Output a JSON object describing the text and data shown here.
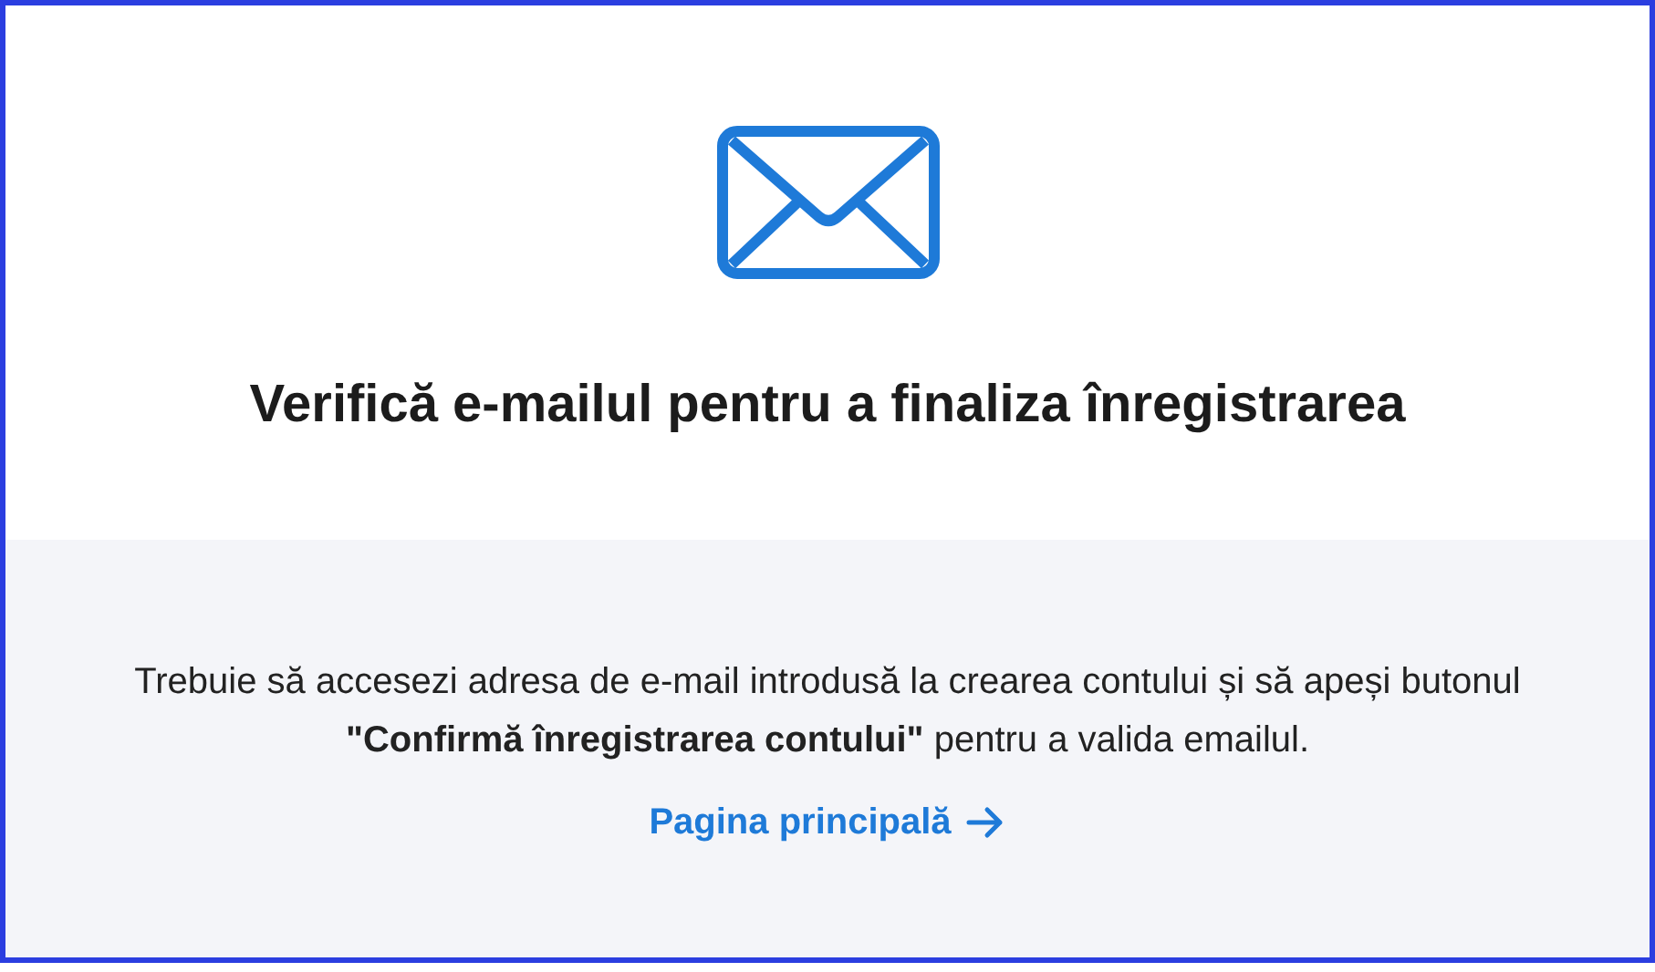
{
  "heading": "Verifică e-mailul pentru a finaliza înregistrarea",
  "message": "Trebuie să accesezi adresa de e-mail introdusă la crearea contului și să apeși butonul **\"Confirmă înregistrarea contului\"** pentru a valida emailul.",
  "link": {
    "label": "Pagina principală"
  }
}
